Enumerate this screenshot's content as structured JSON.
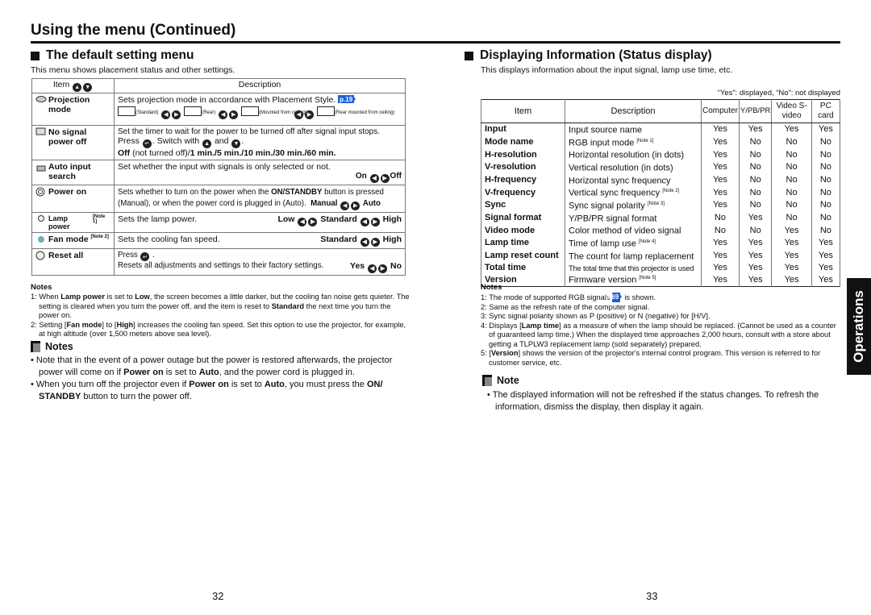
{
  "header": {
    "title": "Using the menu (Continued)"
  },
  "left": {
    "section_title": "The default setting menu",
    "section_sub": "This menu shows placement status and other settings.",
    "table": {
      "col_item": "Item",
      "col_desc": "Description",
      "rows": [
        {
          "name": "Projection mode",
          "icon": "projection-icon",
          "desc": "Sets projection mode in accordance with Placement Style.",
          "page_ref": "p.19",
          "options": [
            "(Standard)",
            "(Rear)",
            "(Mounted from ceiling)",
            "(Rear mounted from ceiling)"
          ]
        },
        {
          "name": "No signal power off",
          "icon": "no-signal-icon",
          "desc": "Set the timer to wait for the power to be turned off after signal input stops.",
          "line2_a": "Press",
          "line2_b": ". Switch with",
          "line2_c": "and",
          "line3_bold_a": "Off",
          "line3_normal": " (not turned off)/",
          "line3_bold_b": "1 min./5 min./10 min./30 min./60 min."
        },
        {
          "name": "Auto input search",
          "icon": "auto-input-icon",
          "desc": "Set whether the input with signals is only selected or not.",
          "opt_a": "On",
          "opt_b": "Off"
        },
        {
          "name": "Power on",
          "icon": "power-on-icon",
          "desc_a": "Sets whether to turn on the power when the ",
          "desc_bold": "ON/STANDBY",
          "desc_b": " button is pressed (Manual), or when the power cord is plugged in (Auto).",
          "opt_a": "Manual",
          "opt_b": "Auto"
        },
        {
          "name": "Lamp power",
          "note": "[Note 1]",
          "icon": "lamp-icon",
          "desc": "Sets the lamp power.",
          "opt_a": "Low",
          "opt_b": "Standard",
          "opt_c": "High"
        },
        {
          "name": "Fan mode",
          "note": "[Note 2]",
          "icon": "fan-icon",
          "desc": "Sets the cooling fan speed.",
          "opt_a": "Standard",
          "opt_b": "High"
        },
        {
          "name": "Reset all",
          "icon": "reset-icon",
          "line1": "Press",
          "desc": "Resets all adjustments and settings to their factory settings.",
          "opt_a": "Yes",
          "opt_b": "No"
        }
      ]
    },
    "notes_title": "Notes",
    "notes": [
      {
        "num": "1:",
        "a": "When ",
        "b1": "Lamp power",
        "c": " is set to ",
        "b2": "Low",
        "d": ", the screen becomes a little darker, but the cooling fan noise gets quieter. The setting is cleared when you turn the power off, and the item is reset to ",
        "b3": "Standard",
        "e": " the next time you turn the power on."
      },
      {
        "num": "2:",
        "a": "Setting [",
        "b1": "Fan mode",
        "c": "] to [",
        "b2": "High",
        "d": "] increases the cooling fan speed.  Set this option to use the projector, for example, at high altitude (over 1,500 meters above sea level)."
      }
    ],
    "box_title": "Notes",
    "bullets": [
      {
        "a": "Note that in the event of a power outage but the power is restored afterwards, the projector power will come on if ",
        "b1": "Power on",
        "c": " is set to ",
        "b2": "Auto",
        "d": ", and the power cord is plugged in."
      },
      {
        "a": "When you turn off the projector even if ",
        "b1": "Power on",
        "c": " is set to ",
        "b2": "Auto",
        "d": ", you must press the ",
        "b3": "ON/ STANDBY",
        "e": " button to turn the power off."
      }
    ],
    "page_number": "32"
  },
  "right": {
    "section_title": "Displaying Information (Status display)",
    "section_sub": "This displays information about the input signal, lamp use time, etc.",
    "legend": "“Yes”: displayed, “No”: not displayed",
    "table": {
      "headers": [
        "Item",
        "Description",
        "Computer",
        "Y/PB/PR",
        "Video S-video",
        "PC card"
      ],
      "rows": [
        {
          "item": "Input",
          "desc": "Input source name",
          "note": "",
          "v": [
            "Yes",
            "Yes",
            "Yes",
            "Yes"
          ]
        },
        {
          "item": "Mode name",
          "desc": "RGB input mode",
          "note": "[Note 1]",
          "v": [
            "Yes",
            "No",
            "No",
            "No"
          ]
        },
        {
          "item": "H-resolution",
          "desc": "Horizontal resolution (in dots)",
          "note": "",
          "v": [
            "Yes",
            "No",
            "No",
            "No"
          ]
        },
        {
          "item": "V-resolution",
          "desc": "Vertical resolution (in dots)",
          "note": "",
          "v": [
            "Yes",
            "No",
            "No",
            "No"
          ]
        },
        {
          "item": "H-frequency",
          "desc": "Horizontal sync frequency",
          "note": "",
          "v": [
            "Yes",
            "No",
            "No",
            "No"
          ]
        },
        {
          "item": "V-frequency",
          "desc": "Vertical sync frequency",
          "note": "[Note 2]",
          "v": [
            "Yes",
            "No",
            "No",
            "No"
          ]
        },
        {
          "item": "Sync",
          "desc": "Sync signal polarity",
          "note": "[Note 3]",
          "v": [
            "Yes",
            "No",
            "No",
            "No"
          ]
        },
        {
          "item": "Signal format",
          "desc": "Y/PB/PR signal format",
          "note": "",
          "v": [
            "No",
            "Yes",
            "No",
            "No"
          ]
        },
        {
          "item": "Video mode",
          "desc": "Color method of video signal",
          "note": "",
          "v": [
            "No",
            "No",
            "Yes",
            "No"
          ]
        },
        {
          "item": "Lamp time",
          "desc": "Time of lamp use",
          "note": "[Note 4]",
          "v": [
            "Yes",
            "Yes",
            "Yes",
            "Yes"
          ]
        },
        {
          "item": "Lamp reset count",
          "desc": "The count for lamp replacement",
          "note": "",
          "v": [
            "Yes",
            "Yes",
            "Yes",
            "Yes"
          ]
        },
        {
          "item": "Total time",
          "desc": "The total time that this projector is used",
          "note": "",
          "v": [
            "Yes",
            "Yes",
            "Yes",
            "Yes"
          ]
        },
        {
          "item": "Version",
          "desc": "Firmware version",
          "note": "[Note 5]",
          "v": [
            "Yes",
            "Yes",
            "Yes",
            "Yes"
          ]
        }
      ]
    },
    "notes_title": "Notes",
    "notes": [
      {
        "num": "1:",
        "text_a": "The mode of supported RGB signals ",
        "ref": "p.69",
        "text_b": " is shown."
      },
      {
        "num": "2:",
        "text_a": "Same as the refresh rate of the computer signal."
      },
      {
        "num": "3:",
        "text_a": "Sync signal polarity shown as P (positive) or N (negative) for [H/V]."
      },
      {
        "num": "4:",
        "text_a": "Displays [",
        "bold": "Lamp time",
        "text_b": "] as a measure of when the lamp should be replaced. (Cannot be used as a counter of guaranteed lamp time.) When the displayed time approaches 2,000 hours, consult with a store about getting a TLPLW3 replacement lamp (sold separately) prepared."
      },
      {
        "num": "5:",
        "text_a": "[",
        "bold": "Version",
        "text_b": "] shows the version of the projector's internal control program. This version is referred to for customer service, etc."
      }
    ],
    "box_title": "Note",
    "bullets": [
      "The displayed information will not be refreshed if the status changes. To refresh the information, dismiss the display, then display it again."
    ],
    "page_number": "33",
    "side_tab": "Operations"
  },
  "colors": {
    "page_ref_blue": "#1f5fd6",
    "side_tab_bg": "#111111"
  }
}
